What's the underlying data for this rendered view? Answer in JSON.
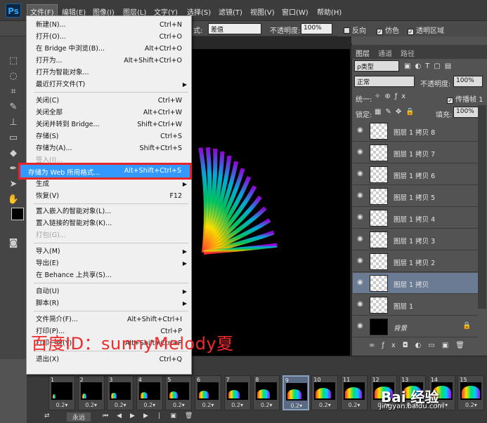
{
  "menubar": {
    "logo": "Ps",
    "items": [
      "文件(F)",
      "编辑(E)",
      "图像(I)",
      "图层(L)",
      "文字(Y)",
      "选择(S)",
      "滤镜(T)",
      "视图(V)",
      "窗口(W)",
      "帮助(H)"
    ]
  },
  "options": {
    "mode_label": "式:",
    "mode_value": "差值",
    "opacity_label": "不透明度:",
    "opacity_value": "100%",
    "reverse_label": "反向",
    "dither_label": "仿色",
    "transparency_label": "透明区域"
  },
  "file_menu": {
    "items": [
      {
        "label": "新建(N)...",
        "shortcut": "Ctrl+N"
      },
      {
        "label": "打开(O)...",
        "shortcut": "Ctrl+O"
      },
      {
        "label": "在 Bridge 中浏览(B)...",
        "shortcut": "Alt+Ctrl+O"
      },
      {
        "label": "打开为...",
        "shortcut": "Alt+Shift+Ctrl+O"
      },
      {
        "label": "打开为智能对象...",
        "shortcut": ""
      },
      {
        "label": "最近打开文件(T)",
        "shortcut": ""
      },
      {
        "label": "关闭(C)",
        "shortcut": "Ctrl+W"
      },
      {
        "label": "关闭全部",
        "shortcut": "Alt+Ctrl+W"
      },
      {
        "label": "关闭并转到 Bridge...",
        "shortcut": "Shift+Ctrl+W"
      },
      {
        "label": "存储(S)",
        "shortcut": "Ctrl+S"
      },
      {
        "label": "存储为(A)...",
        "shortcut": "Shift+Ctrl+S"
      },
      {
        "label": "签入(I)...",
        "shortcut": ""
      },
      {
        "label": "存储为 Web 所用格式...",
        "shortcut": "Alt+Shift+Ctrl+S"
      },
      {
        "label": "生成",
        "shortcut": ""
      },
      {
        "label": "恢复(V)",
        "shortcut": "F12"
      },
      {
        "label": "置入嵌入的智能对象(L)...",
        "shortcut": ""
      },
      {
        "label": "置入链接的智能对象(K)...",
        "shortcut": ""
      },
      {
        "label": "打包(G)...",
        "shortcut": ""
      },
      {
        "label": "导入(M)",
        "shortcut": ""
      },
      {
        "label": "导出(E)",
        "shortcut": ""
      },
      {
        "label": "在 Behance 上共享(S)...",
        "shortcut": ""
      },
      {
        "label": "自动(U)",
        "shortcut": ""
      },
      {
        "label": "脚本(R)",
        "shortcut": ""
      },
      {
        "label": "文件简介(F)...",
        "shortcut": "Alt+Shift+Ctrl+I"
      },
      {
        "label": "打印(P)...",
        "shortcut": "Ctrl+P"
      },
      {
        "label": "打印一份(Y)",
        "shortcut": "Alt+Shift+Ctrl+P"
      },
      {
        "label": "退出(X)",
        "shortcut": "Ctrl+Q"
      }
    ]
  },
  "watermark": "百度ID：sunnyMelody夏",
  "layers_panel": {
    "tabs": [
      "图层",
      "通道",
      "路径"
    ],
    "filter_label": "ρ类型",
    "blend_mode": "正常",
    "opacity_label": "不透明度:",
    "opacity_value": "100%",
    "unify_label": "统一:",
    "propagate_label": "传播帧 1",
    "lock_label": "锁定:",
    "fill_label": "填充:",
    "fill_value": "100%",
    "layers": [
      {
        "name": "图层 1 拷贝 8"
      },
      {
        "name": "图层 1 拷贝 7"
      },
      {
        "name": "图层 1 拷贝 6"
      },
      {
        "name": "图层 1 拷贝 5"
      },
      {
        "name": "图层 1 拷贝 4"
      },
      {
        "name": "图层 1 拷贝 3"
      },
      {
        "name": "图层 1 拷贝 2"
      },
      {
        "name": "图层 1 拷贝"
      },
      {
        "name": "图层 1"
      },
      {
        "name": "背景"
      }
    ]
  },
  "timeline": {
    "frames": [
      {
        "num": "1",
        "delay": "0.2"
      },
      {
        "num": "2",
        "delay": "0.2"
      },
      {
        "num": "3",
        "delay": "0.2"
      },
      {
        "num": "4",
        "delay": "0.2"
      },
      {
        "num": "5",
        "delay": "0.2"
      },
      {
        "num": "6",
        "delay": "0.2"
      },
      {
        "num": "7",
        "delay": "0.2"
      },
      {
        "num": "8",
        "delay": "0.2"
      },
      {
        "num": "9",
        "delay": "0.2"
      },
      {
        "num": "10",
        "delay": "0.2"
      },
      {
        "num": "11",
        "delay": "0.2"
      },
      {
        "num": "12",
        "delay": "0.2"
      },
      {
        "num": "13",
        "delay": "0.2"
      },
      {
        "num": "14",
        "delay": "0.2"
      },
      {
        "num": "15",
        "delay": "0.2"
      }
    ],
    "loop_value": "永远"
  },
  "site_watermark": {
    "brand": "Bai 经验",
    "url": "jingyan.baidu.com"
  }
}
